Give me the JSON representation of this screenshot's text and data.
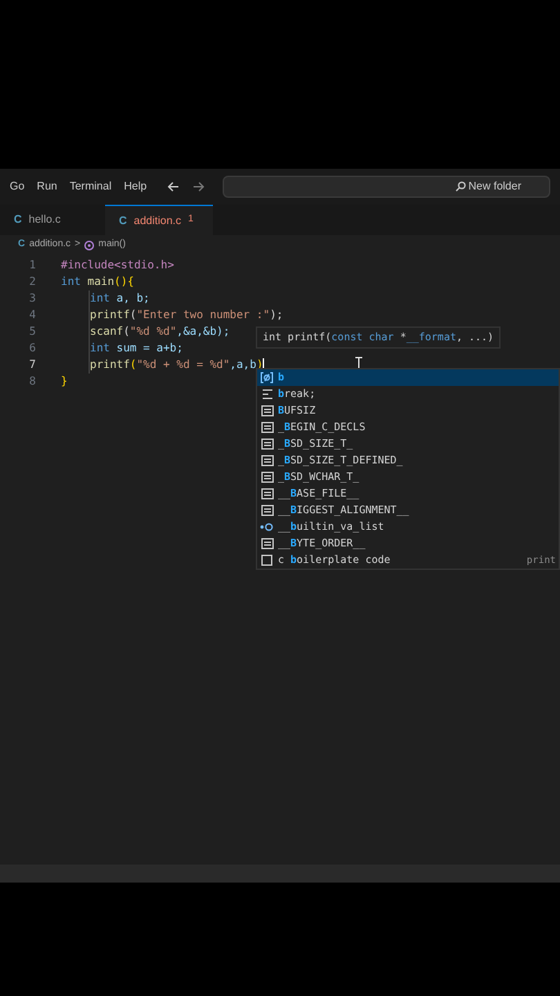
{
  "menu": [
    "Go",
    "Run",
    "Terminal",
    "Help"
  ],
  "search": {
    "value": "New folder"
  },
  "tabs": [
    {
      "label": "hello.c",
      "icon": "C",
      "selected": false,
      "modified": false
    },
    {
      "label": "addition.c",
      "icon": "C",
      "selected": true,
      "error_count": "1",
      "modified": true
    }
  ],
  "breadcrumb": {
    "icon": "C",
    "file": "addition.c",
    "separator": ">",
    "symbol": "main()"
  },
  "code": [
    {
      "number": "1",
      "indented": false,
      "tokens": [
        {
          "kind": "preproc",
          "text": "#include<stdio.h>"
        }
      ]
    },
    {
      "number": "2",
      "indented": false,
      "tokens": [
        {
          "kind": "keyword",
          "text": "int"
        },
        {
          "kind": "func",
          "text": " main"
        },
        {
          "kind": "bracket",
          "text": "(){"
        }
      ]
    },
    {
      "number": "3",
      "indented": true,
      "tokens": [
        {
          "kind": "keyword",
          "text": "int"
        },
        {
          "kind": "var",
          "text": " a, b;"
        }
      ]
    },
    {
      "number": "4",
      "indented": true,
      "tokens": [
        {
          "kind": "func",
          "text": "printf"
        },
        {
          "kind": "plain",
          "text": "("
        },
        {
          "kind": "string",
          "text": "\"Enter two number :\""
        },
        {
          "kind": "plain",
          "text": ");"
        }
      ]
    },
    {
      "number": "5",
      "indented": true,
      "tokens": [
        {
          "kind": "func",
          "text": "scanf"
        },
        {
          "kind": "plain",
          "text": "("
        },
        {
          "kind": "string",
          "text": "\"%d %d\""
        },
        {
          "kind": "var",
          "text": ",&a,&b);"
        }
      ]
    },
    {
      "number": "6",
      "indented": true,
      "tokens": [
        {
          "kind": "keyword",
          "text": "int"
        },
        {
          "kind": "var",
          "text": " sum = a+b;"
        }
      ]
    },
    {
      "number": "7",
      "indented": true,
      "cursor": true,
      "tokens": [
        {
          "kind": "func",
          "text": "printf"
        },
        {
          "kind": "bracket",
          "text": "("
        },
        {
          "kind": "string",
          "text": "\"%d + %d = %d\""
        },
        {
          "kind": "var",
          "text": ",a,b"
        },
        {
          "kind": "bracket",
          "text": ")"
        }
      ]
    },
    {
      "number": "8",
      "indented": false,
      "tokens": [
        {
          "kind": "bracket",
          "text": "}"
        }
      ]
    }
  ],
  "hover": {
    "parts": [
      {
        "kind": "plain",
        "text": "int printf("
      },
      {
        "kind": "keyword",
        "text": "const char"
      },
      {
        "kind": "plain",
        "text": " *"
      },
      {
        "kind": "keyword",
        "text": "__format"
      },
      {
        "kind": "plain",
        "text": ", ...)"
      }
    ]
  },
  "suggestions": [
    {
      "kind": "variable",
      "selected": true,
      "parts": [
        {
          "text": "b",
          "match": true
        }
      ]
    },
    {
      "kind": "snippet",
      "selected": false,
      "parts": [
        {
          "text": "b",
          "match": true
        },
        {
          "text": "reak;",
          "match": false
        }
      ]
    },
    {
      "kind": "constant",
      "selected": false,
      "parts": [
        {
          "text": "B",
          "match": true
        },
        {
          "text": "UFSIZ",
          "match": false
        }
      ]
    },
    {
      "kind": "constant",
      "selected": false,
      "parts": [
        {
          "text": "_",
          "match": false
        },
        {
          "text": "B",
          "match": true
        },
        {
          "text": "EGIN_C_DECLS",
          "match": false
        }
      ]
    },
    {
      "kind": "constant",
      "selected": false,
      "parts": [
        {
          "text": "_",
          "match": false
        },
        {
          "text": "B",
          "match": true
        },
        {
          "text": "SD_SIZE_T_",
          "match": false
        }
      ]
    },
    {
      "kind": "constant",
      "selected": false,
      "parts": [
        {
          "text": "_",
          "match": false
        },
        {
          "text": "B",
          "match": true
        },
        {
          "text": "SD_SIZE_T_DEFINED_",
          "match": false
        }
      ]
    },
    {
      "kind": "constant",
      "selected": false,
      "parts": [
        {
          "text": "_",
          "match": false
        },
        {
          "text": "B",
          "match": true
        },
        {
          "text": "SD_WCHAR_T_",
          "match": false
        }
      ]
    },
    {
      "kind": "constant",
      "selected": false,
      "parts": [
        {
          "text": "__",
          "match": false
        },
        {
          "text": "B",
          "match": true
        },
        {
          "text": "ASE_FILE__",
          "match": false
        }
      ]
    },
    {
      "kind": "constant",
      "selected": false,
      "parts": [
        {
          "text": "__",
          "match": false
        },
        {
          "text": "B",
          "match": true
        },
        {
          "text": "IGGEST_ALIGNMENT__",
          "match": false
        }
      ]
    },
    {
      "kind": "field",
      "selected": false,
      "parts": [
        {
          "text": "__",
          "match": false
        },
        {
          "text": "b",
          "match": true
        },
        {
          "text": "uiltin_va_list",
          "match": false
        }
      ]
    },
    {
      "kind": "constant",
      "selected": false,
      "parts": [
        {
          "text": "__",
          "match": false
        },
        {
          "text": "B",
          "match": true
        },
        {
          "text": "YTE_ORDER__",
          "match": false
        }
      ]
    },
    {
      "kind": "text",
      "selected": false,
      "parts": [
        {
          "text": "c ",
          "match": false
        },
        {
          "text": "b",
          "match": true
        },
        {
          "text": "oilerplate code",
          "match": false
        }
      ],
      "detail": "print"
    }
  ]
}
